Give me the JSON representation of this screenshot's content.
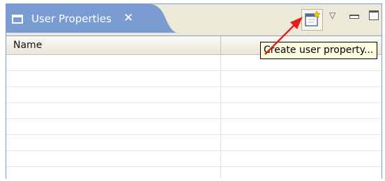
{
  "view": {
    "title": "User Properties",
    "close_glyph": "✕",
    "toolbar": {
      "create_button_icon": "create-property-icon",
      "view_menu_glyph": "▽",
      "minimize_icon": "minimize-icon",
      "maximize_icon": "maximize-icon"
    },
    "tooltip": "Create user property..."
  },
  "table": {
    "columns": [
      "Name",
      ""
    ],
    "rows": [
      [
        "",
        ""
      ],
      [
        "",
        ""
      ],
      [
        "",
        ""
      ],
      [
        "",
        ""
      ],
      [
        "",
        ""
      ],
      [
        "",
        ""
      ],
      [
        "",
        ""
      ],
      [
        "",
        ""
      ]
    ]
  },
  "colors": {
    "tab_active": "#7a9cd3",
    "annotation_arrow": "#e3201b",
    "tooltip_bg": "#ffffe1"
  }
}
